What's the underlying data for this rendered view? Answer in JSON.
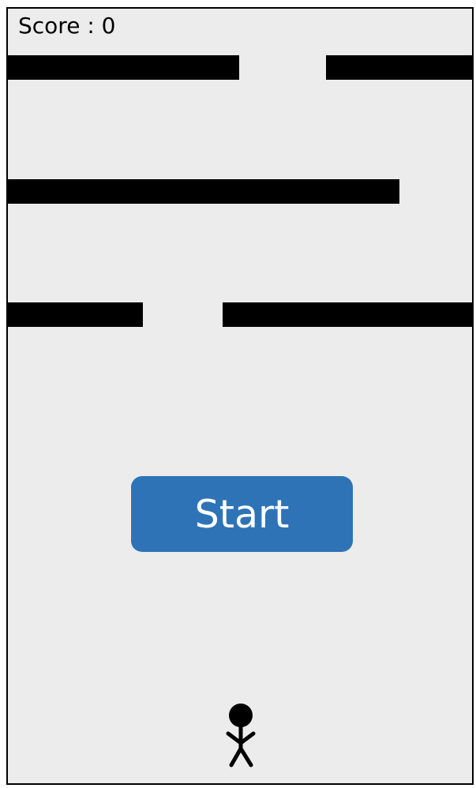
{
  "hud": {
    "score_text": "Score : 0"
  },
  "start_button": {
    "label": "Start",
    "color": "#2f73b7"
  },
  "colors": {
    "background": "#ececec",
    "border": "#000000",
    "bars": "#000000"
  },
  "player": {
    "icon": "stick-figure-icon"
  }
}
